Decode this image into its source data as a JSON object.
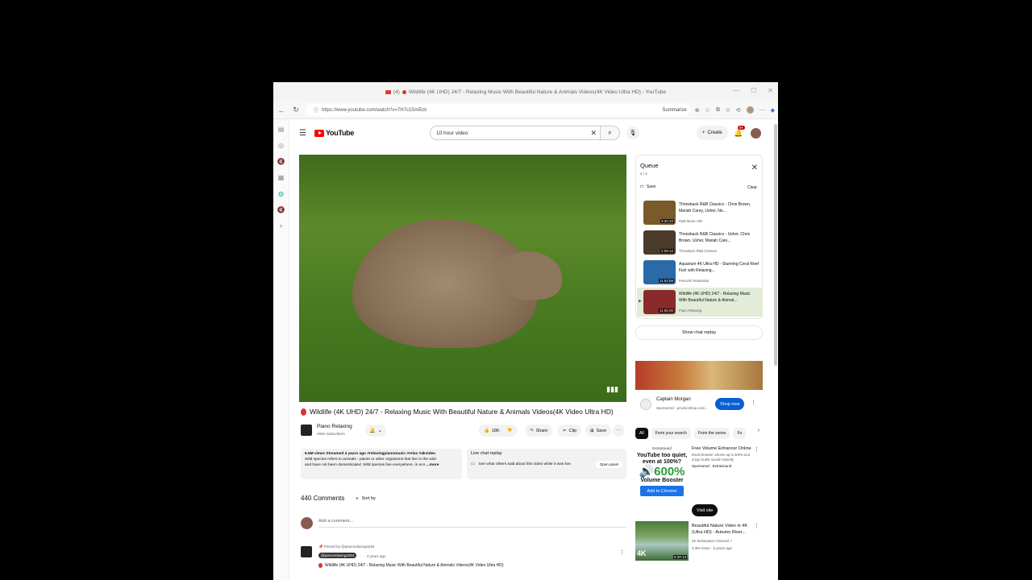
{
  "browser": {
    "window_title": "Wildlife (4K UHD) 24/7 - Relaxing Music With Beautiful Nature & Animals Videos(4K Video Ultra HD) - YouTube",
    "tab_prefix": "(4)",
    "url": "https://www.youtube.com/watch?v=7H7c15mi5zk",
    "summarize_label": "Summarize",
    "window_controls": [
      "—",
      "☐",
      "✕"
    ]
  },
  "youtube": {
    "logo_text": "YouTube",
    "search_value": "10 hour video",
    "create_label": "Create",
    "notification_count": "9+"
  },
  "video": {
    "title": "Wildlife (4K UHD) 24/7 - Relaxing Music With Beautiful Nature & Animals Videos(4K Video Ultra HD)",
    "channel_name": "Piano Relaxing",
    "subscribers": "284K subscribers",
    "likes": "18K",
    "share_label": "Share",
    "clip_label": "Clip",
    "save_label": "Save",
    "description_meta": "6.5M views  Streamed 4 years ago  #relaxingpianomusic #relax #4kvideo",
    "description_line1": "Wild species refers to animals - plants or other organisms that live in the wild",
    "description_line2": "and have not been domesticated. Wild species live everywhere, in eco",
    "description_more": "...more",
    "live_chat_label": "Live chat replay",
    "live_chat_text": "See what others said about this video while it was live.",
    "open_panel_label": "Open panel"
  },
  "comments": {
    "count_label": "440 Comments",
    "sort_label": "Sort by",
    "placeholder": "Add a comment...",
    "pinned_label": "Pinned by @pianorelaxing4254",
    "pinned_handle": "@pianorelaxing4254",
    "pinned_ago": "4 years ago",
    "pinned_text": "Wildlife (4K UHD) 24/7 - Relaxing Music With Beautiful Nature & Animals Videos(4K Video Ultra HD)"
  },
  "queue": {
    "title": "Queue",
    "count": "4 / 4",
    "save_label": "Save",
    "clear_label": "Clear",
    "items": [
      {
        "title": "Throwback R&B Classics - Chris Brown, Mariah Carey, Usher, Ne...",
        "channel": "R&B Music Hits",
        "duration": "3:20:10",
        "color": "#7a5a2a"
      },
      {
        "title": "Throwback R&B Classics - Usher, Chris Brown, Usher, Mariah Care...",
        "channel": "Throwback R&B Classics",
        "duration": "2:08:12",
        "color": "#4a3a2a"
      },
      {
        "title": "Aquarium 4K Ultra HD - Stunning Coral Reef Fish with Relaxing...",
        "channel": "Peaceful Relaxation",
        "duration": "11:54:58",
        "color": "#2a6aa8"
      },
      {
        "title": "Wildlife (4K UHD) 24/7 - Relaxing Music With Beautiful Nature & Animal...",
        "channel": "Piano Relaxing",
        "duration": "11:55:00",
        "color": "#8a2a2a"
      }
    ]
  },
  "sidebar": {
    "chat_replay_label": "Show chat replay",
    "ad1_name": "Captain Morgan",
    "ad1_sponsored": "Sponsored · productshop.com...",
    "ad1_cta": "Shop now",
    "chips": [
      "All",
      "From your search",
      "From the series",
      "Fo"
    ],
    "ad2_brand": "ExtraSound",
    "ad2_q": "YouTube too quiet, even at 100%?",
    "ad2_big": "600%",
    "ad2_vb": "Volume Booster",
    "ad2_cta": "Add to Chrome",
    "ad2_title": "Free Volume Enhancer Online",
    "ad2_desc": "Boost browser volume up to 600% and enjoy louder sound instantly",
    "ad2_sponsored": "Sponsored · ExtraSound",
    "ad2_visit": "Visit site",
    "rec_title": "Beautiful Nature Video in 4K (Ultra HD) - Autumn River...",
    "rec_channel": "4K Relaxation Channel",
    "rec_views": "4.3M views · 5 years ago",
    "rec_duration": "5:30:13",
    "rec_tag": "4K"
  }
}
